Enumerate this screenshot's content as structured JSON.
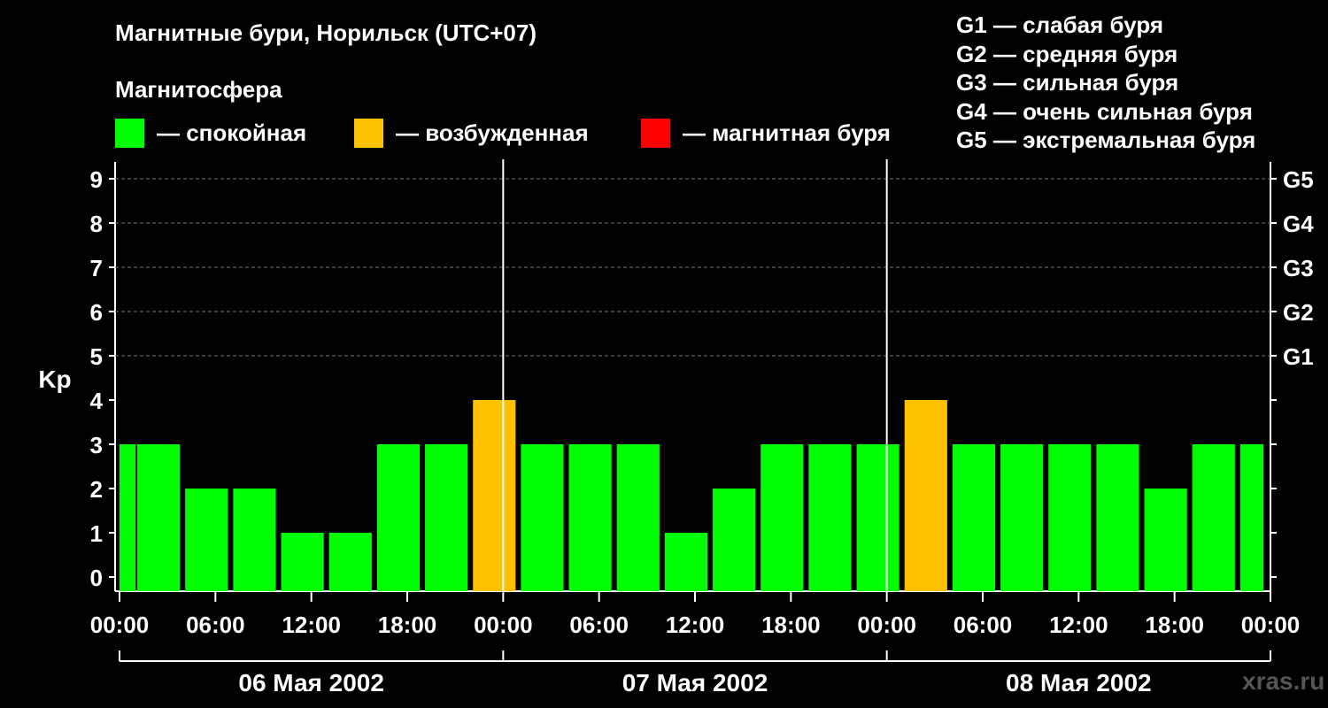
{
  "title": "Магнитные бури, Норильск (UTC+07)",
  "subtitle": "Магнитосфера",
  "colors": {
    "background": "#000000",
    "quiet": "#00ff00",
    "active": "#ffc000",
    "storm": "#ff0000",
    "text": "#ffffff",
    "grid": "#777777",
    "watermark": "#555555"
  },
  "legend": [
    {
      "color": "#00ff00",
      "label": "— спокойная"
    },
    {
      "color": "#ffc000",
      "label": "— возбужденная"
    },
    {
      "color": "#ff0000",
      "label": "— магнитная буря"
    }
  ],
  "g_legend": [
    "G1 — слабая буря",
    "G2 — средняя буря",
    "G3 — сильная буря",
    "G4 — очень сильная буря",
    "G5 — экстремальная буря"
  ],
  "watermark": "xras.ru",
  "chart_data": {
    "type": "bar",
    "ylabel": "Kp",
    "ylim": [
      0,
      9
    ],
    "y_ticks": [
      "0",
      "1",
      "2",
      "3",
      "4",
      "5",
      "6",
      "7",
      "8",
      "9"
    ],
    "right_ticks": [
      {
        "value": 5,
        "label": "G1"
      },
      {
        "value": 6,
        "label": "G2"
      },
      {
        "value": 7,
        "label": "G3"
      },
      {
        "value": 8,
        "label": "G4"
      },
      {
        "value": 9,
        "label": "G5"
      }
    ],
    "grid": "dashed horizontal at Kp 5-9",
    "x_tick_labels": [
      "00:00",
      "06:00",
      "12:00",
      "18:00",
      "00:00",
      "06:00",
      "12:00",
      "18:00",
      "00:00",
      "06:00",
      "12:00",
      "18:00",
      "00:00"
    ],
    "days": [
      "06 Мая 2002",
      "07 Мая 2002",
      "08 Мая 2002"
    ],
    "interval_hours": 3,
    "values": [
      3,
      2,
      2,
      1,
      1,
      3,
      3,
      4,
      3,
      3,
      3,
      1,
      2,
      3,
      3,
      3,
      4,
      3,
      3,
      3,
      3,
      2,
      3,
      3
    ],
    "first_bar": 3
  }
}
